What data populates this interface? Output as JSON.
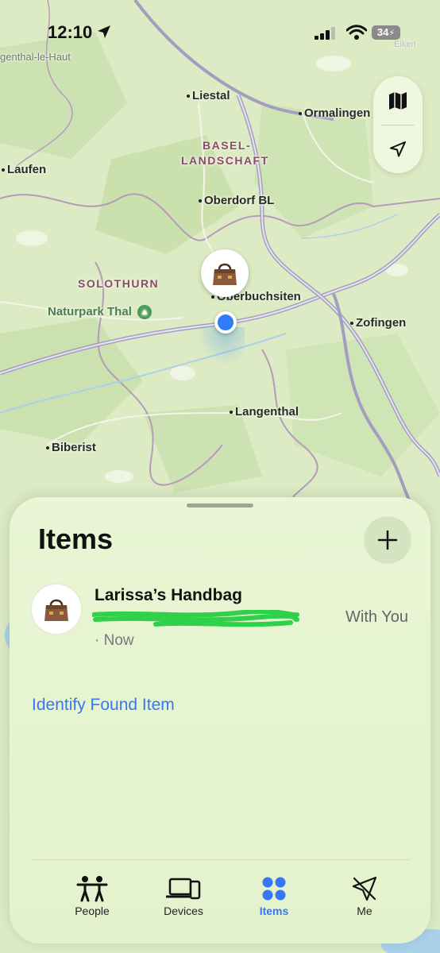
{
  "status_bar": {
    "time": "12:10",
    "battery": "34"
  },
  "map": {
    "labels": {
      "genthal": "genthal-le-Haut",
      "liestal": "Liestal",
      "ormalingen": "Ormalingen",
      "basel_1": "BASEL-",
      "basel_2": "LANDSCHAFT",
      "laufen": "Laufen",
      "oberdorf": "Oberdorf BL",
      "solothurn": "SOLOTHURN",
      "oberbuchsiten": "Oberbuchsiten",
      "naturpark": "Naturpark Thal",
      "zofingen": "Zofingen",
      "langenthal": "Langenthal",
      "biberist": "Biberist",
      "eiken": "Eiken"
    }
  },
  "sheet": {
    "title": "Items",
    "item": {
      "name": "Larissa’s Handbag",
      "time": "· Now",
      "status": "With You"
    },
    "identify_link": "Identify Found Item"
  },
  "tabs": [
    {
      "label": "People"
    },
    {
      "label": "Devices"
    },
    {
      "label": "Items"
    },
    {
      "label": "Me"
    }
  ],
  "colors": {
    "accent": "#3478f6",
    "map_bg": "#dcebc4",
    "user_dot": "#2f7df6",
    "redaction": "#2fd14a"
  }
}
